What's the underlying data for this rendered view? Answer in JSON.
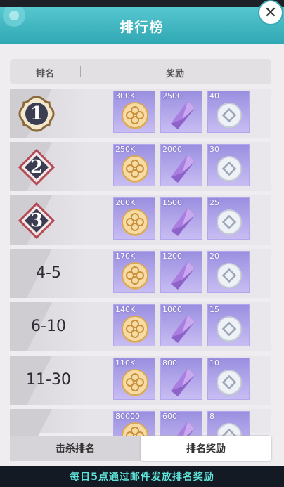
{
  "header": {
    "title": "排行榜",
    "close_icon": "close-icon"
  },
  "table": {
    "col_rank": "排名",
    "col_reward": "奖励"
  },
  "rows": [
    {
      "rank": "1",
      "badge": true,
      "badge_color": "#8a6a3a",
      "rewards": [
        "300K",
        "2500",
        "40"
      ]
    },
    {
      "rank": "2",
      "badge": true,
      "badge_color": "#b54a55",
      "rewards": [
        "250K",
        "2000",
        "30"
      ]
    },
    {
      "rank": "3",
      "badge": true,
      "badge_color": "#b54a55",
      "rewards": [
        "200K",
        "1500",
        "25"
      ]
    },
    {
      "rank": "4-5",
      "badge": false,
      "rewards": [
        "170K",
        "1200",
        "20"
      ]
    },
    {
      "rank": "6-10",
      "badge": false,
      "rewards": [
        "140K",
        "1000",
        "15"
      ]
    },
    {
      "rank": "11-30",
      "badge": false,
      "rewards": [
        "110K",
        "800",
        "10"
      ]
    },
    {
      "rank": "",
      "badge": false,
      "rewards": [
        "80000",
        "600",
        "8"
      ]
    }
  ],
  "reward_icons": [
    "gold-coin-icon",
    "purple-crystal-icon",
    "silver-coin-icon"
  ],
  "tabs": {
    "kill_rank": "击杀排名",
    "rank_reward": "排名奖励",
    "active": "rank_reward"
  },
  "footer": {
    "notice": "每日5点通过邮件发放排名奖励"
  }
}
